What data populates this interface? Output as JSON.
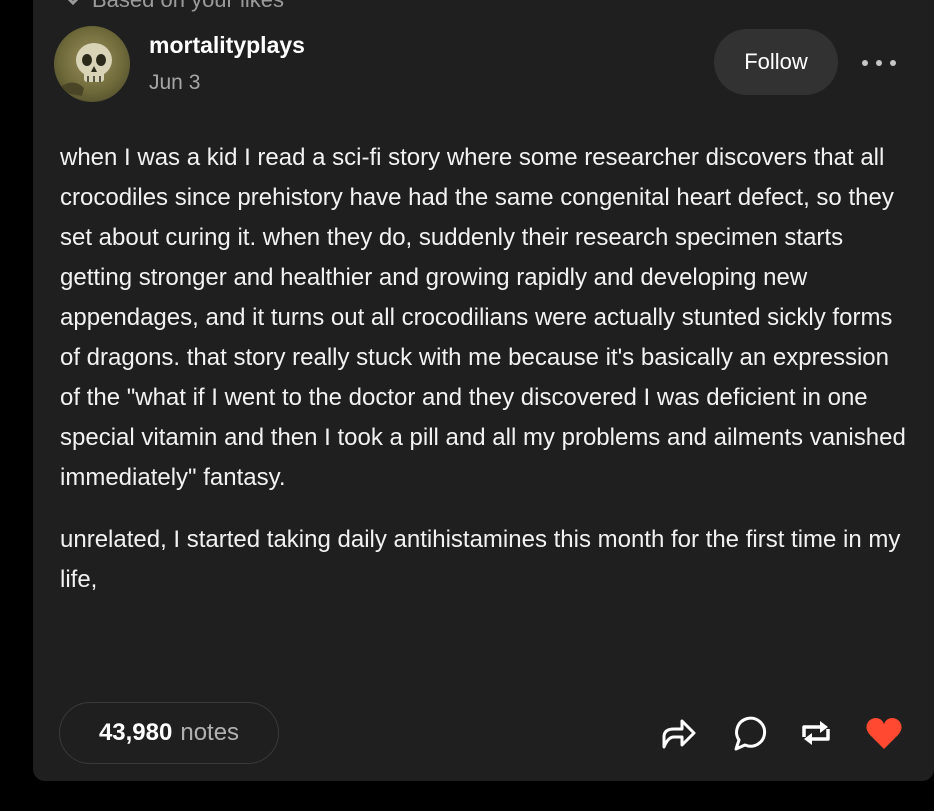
{
  "breadcrumb": {
    "text": "Based on your likes"
  },
  "post": {
    "username": "mortalityplays",
    "date": "Jun 3",
    "follow_label": "Follow",
    "paragraphs": [
      "when I was a kid I read a sci-fi story where some researcher discovers that all crocodiles since prehistory have had the same congenital heart defect, so they set about curing it. when they do, suddenly their research specimen starts getting stronger and healthier and growing rapidly and developing new appendages, and it turns out all crocodilians were actually stunted sickly forms of dragons. that story really stuck with me because it's basically an expression of the \"what if I went to the doctor and they discovered I was deficient in one special vitamin and then I took a pill and all my problems and ailments vanished immediately\" fantasy.",
      "unrelated, I started taking daily antihistamines this month for the first time in my life,"
    ],
    "notes_count": "43,980",
    "notes_label": "notes"
  },
  "icons": {
    "more": "more-options-icon",
    "share": "share-icon",
    "reply": "reply-icon",
    "reblog": "reblog-icon",
    "like": "heart-icon"
  },
  "colors": {
    "background": "#000000",
    "card": "#1f1f1f",
    "button": "#323232",
    "like": "#ff4930"
  }
}
